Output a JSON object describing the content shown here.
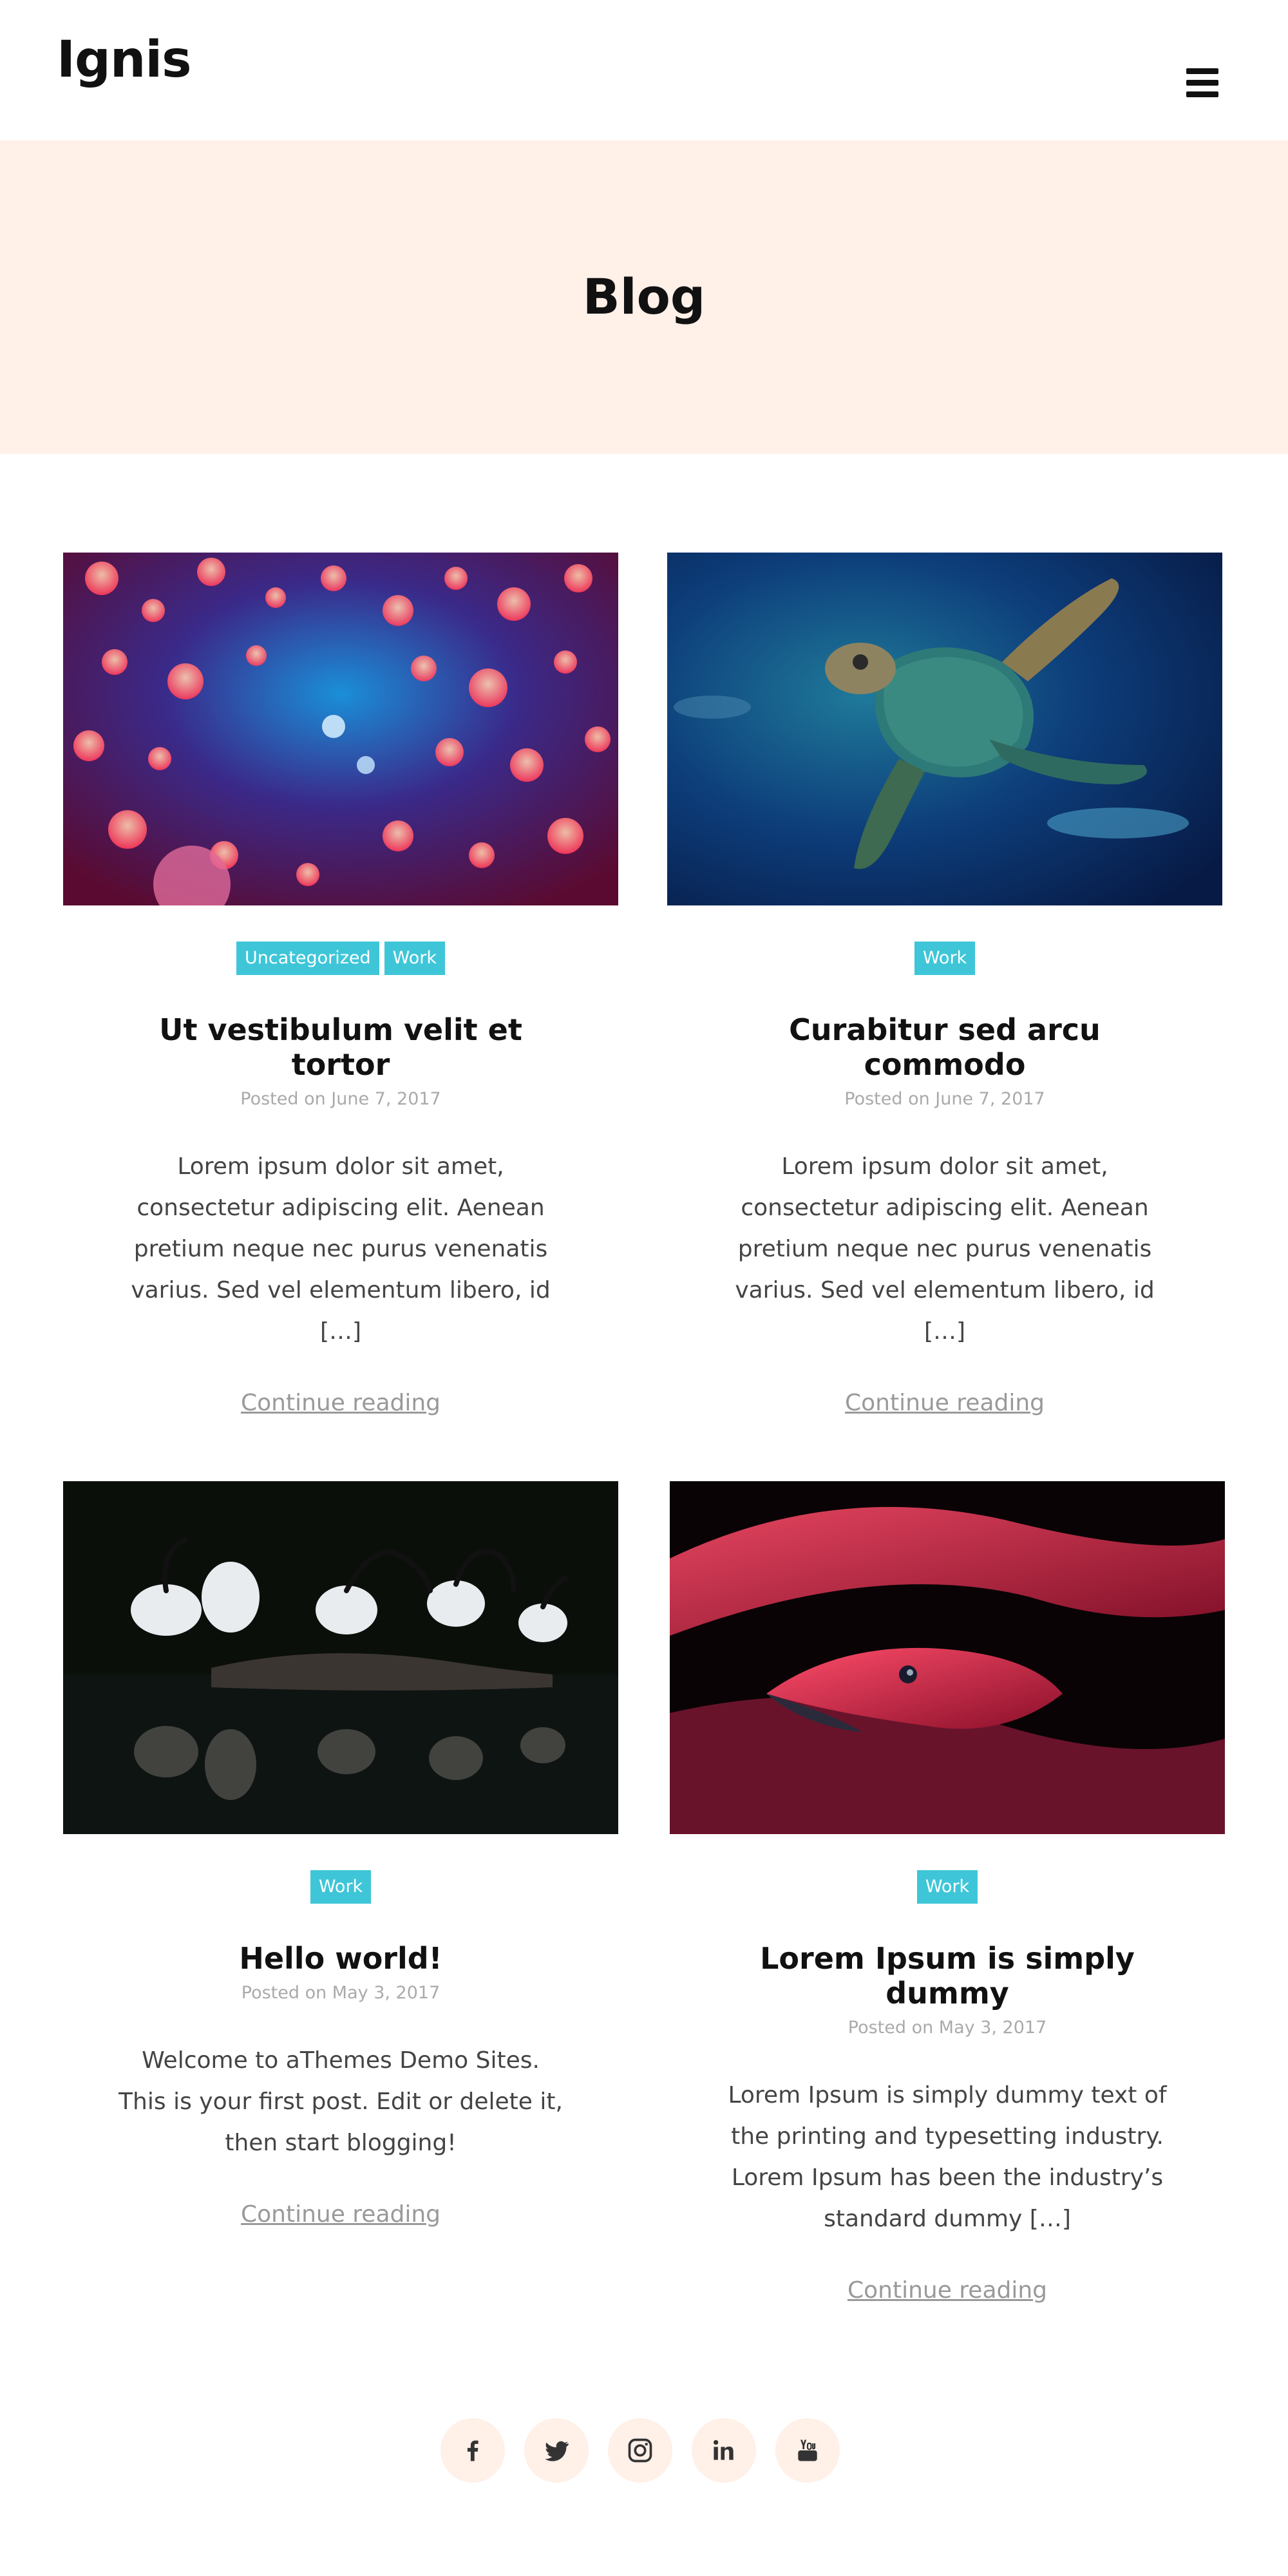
{
  "site": {
    "title": "Ignis"
  },
  "hero": {
    "title": "Blog"
  },
  "posts": [
    {
      "image": "jellyfish-photo",
      "categories": [
        "Uncategorized",
        "Work"
      ],
      "title": "Ut vestibulum velit et tortor",
      "date": "Posted on June 7, 2017",
      "excerpt": "Lorem ipsum dolor sit amet, consectetur adipiscing elit. Aenean pretium neque nec purus venenatis varius. Sed vel elementum libero, id […]",
      "more": "Continue reading"
    },
    {
      "image": "sea-turtle-photo",
      "categories": [
        "Work"
      ],
      "title": "Curabitur sed arcu commodo",
      "date": "Posted on June 7, 2017",
      "excerpt": "Lorem ipsum dolor sit amet, consectetur adipiscing elit. Aenean pretium neque nec purus venenatis varius. Sed vel elementum libero, id […]",
      "more": "Continue reading"
    },
    {
      "image": "ibis-birds-photo",
      "categories": [
        "Work"
      ],
      "title": "Hello world!",
      "date": "Posted on May 3, 2017",
      "excerpt": "Welcome to aThemes Demo Sites. This is your first post. Edit or delete it, then start blogging!",
      "more": "Continue reading"
    },
    {
      "image": "red-snake-photo",
      "categories": [
        "Work"
      ],
      "title": "Lorem Ipsum is simply dummy",
      "date": "Posted on May 3, 2017",
      "excerpt": "Lorem Ipsum is simply dummy text of the printing and typesetting industry. Lorem Ipsum has been the industry’s standard dummy […]",
      "more": "Continue reading"
    }
  ],
  "social": [
    "facebook-icon",
    "twitter-icon",
    "instagram-icon",
    "linkedin-icon",
    "youtube-icon"
  ],
  "colors": {
    "accent": "#3ec6d8",
    "hero_bg": "#fff0e8",
    "social_bg": "#fff0e8"
  }
}
